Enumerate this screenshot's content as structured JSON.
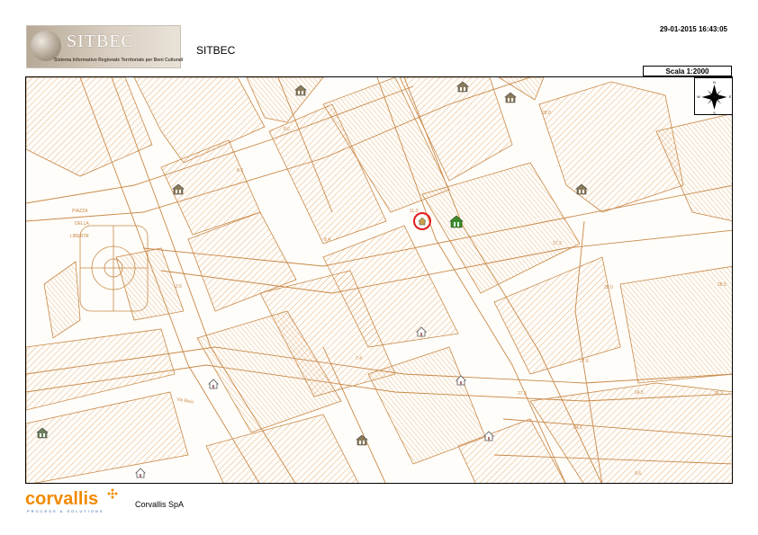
{
  "header": {
    "logo_text": "SITBEC",
    "logo_subtitle": "Sistema Informativo Regionale Territoriale per Beni Culturali",
    "app_title": "SITBEC",
    "timestamp": "29-01-2015 16:43:05",
    "scale_label": "Scala 1:2000"
  },
  "map": {
    "street_color": "#c88848",
    "hatch_color": "#d9a06a",
    "compass_letters": [
      "N",
      "E",
      "S",
      "W"
    ],
    "place_labels": [
      {
        "id": "piazza",
        "text": "PIAZZA"
      },
      {
        "id": "della",
        "text": "DELLA"
      },
      {
        "id": "liberta",
        "text": "LIBERTA'"
      },
      {
        "id": "via-name",
        "text": "Via Bixio"
      },
      {
        "id": "n-28-0a",
        "text": "28.0"
      },
      {
        "id": "n-17-2",
        "text": "17.2"
      },
      {
        "id": "n-28-0b",
        "text": "28.0"
      },
      {
        "id": "n-28-5",
        "text": "28.5"
      },
      {
        "id": "n-27-6",
        "text": "27.6"
      },
      {
        "id": "n-27-3",
        "text": "27.3"
      },
      {
        "id": "n-24-5",
        "text": "24.5"
      },
      {
        "id": "n-29-1",
        "text": "29.1"
      },
      {
        "id": "n-24-1",
        "text": "24.1"
      },
      {
        "id": "n-9-6",
        "text": "9.6"
      },
      {
        "id": "n-8-0",
        "text": "8.0"
      },
      {
        "id": "n-8-3",
        "text": "8.3"
      },
      {
        "id": "n-8-4",
        "text": "8.4"
      },
      {
        "id": "n-2-6",
        "text": "2.6"
      },
      {
        "id": "n-7-4",
        "text": "7.4"
      },
      {
        "id": "n-11",
        "text": "11.0"
      }
    ],
    "markers": [
      {
        "id": "selected-monument",
        "kind": "selected",
        "color": "#e3191b"
      },
      {
        "id": "monument-green",
        "kind": "green",
        "color": "#3d8a2a"
      }
    ]
  },
  "footer": {
    "logo_text": "corvallis",
    "logo_tagline": "PROCESS & SOLUTIONS",
    "company_name": "Corvallis SpA",
    "logo_color": "#f18a00"
  }
}
